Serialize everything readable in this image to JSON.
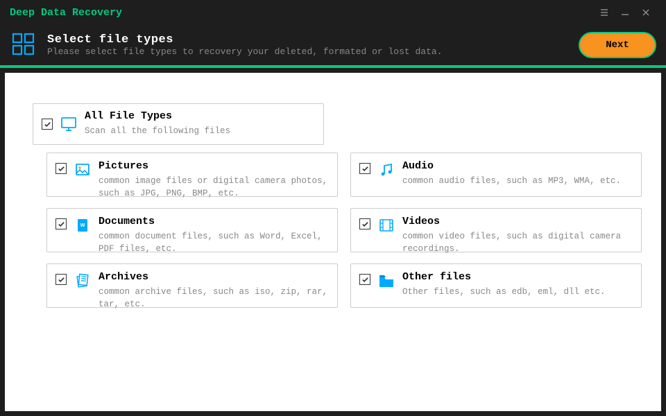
{
  "app": {
    "title": "Deep Data Recovery"
  },
  "header": {
    "title": "Select file types",
    "subtitle": "Please select file types to recovery your deleted, formated or lost data.",
    "next": "Next"
  },
  "all": {
    "label": "All File Types",
    "desc": "Scan all the following files"
  },
  "cards": {
    "pictures": {
      "label": "Pictures",
      "desc": "common image files or digital camera photos, such as JPG, PNG, BMP, etc."
    },
    "audio": {
      "label": "Audio",
      "desc": "common audio files, such as MP3, WMA, etc."
    },
    "documents": {
      "label": "Documents",
      "desc": "common document files, such as Word, Excel, PDF files, etc."
    },
    "videos": {
      "label": "Videos",
      "desc": "common video files, such as digital camera recordings."
    },
    "archives": {
      "label": "Archives",
      "desc": "common archive files, such as iso, zip, rar, tar, etc."
    },
    "other": {
      "label": "Other files",
      "desc": "Other files, such as edb, eml, dll etc."
    }
  },
  "colors": {
    "accent": "#00c980",
    "brand_btn": "#f7931e",
    "muted": "#888888",
    "icon_blue": "#00aaff"
  }
}
